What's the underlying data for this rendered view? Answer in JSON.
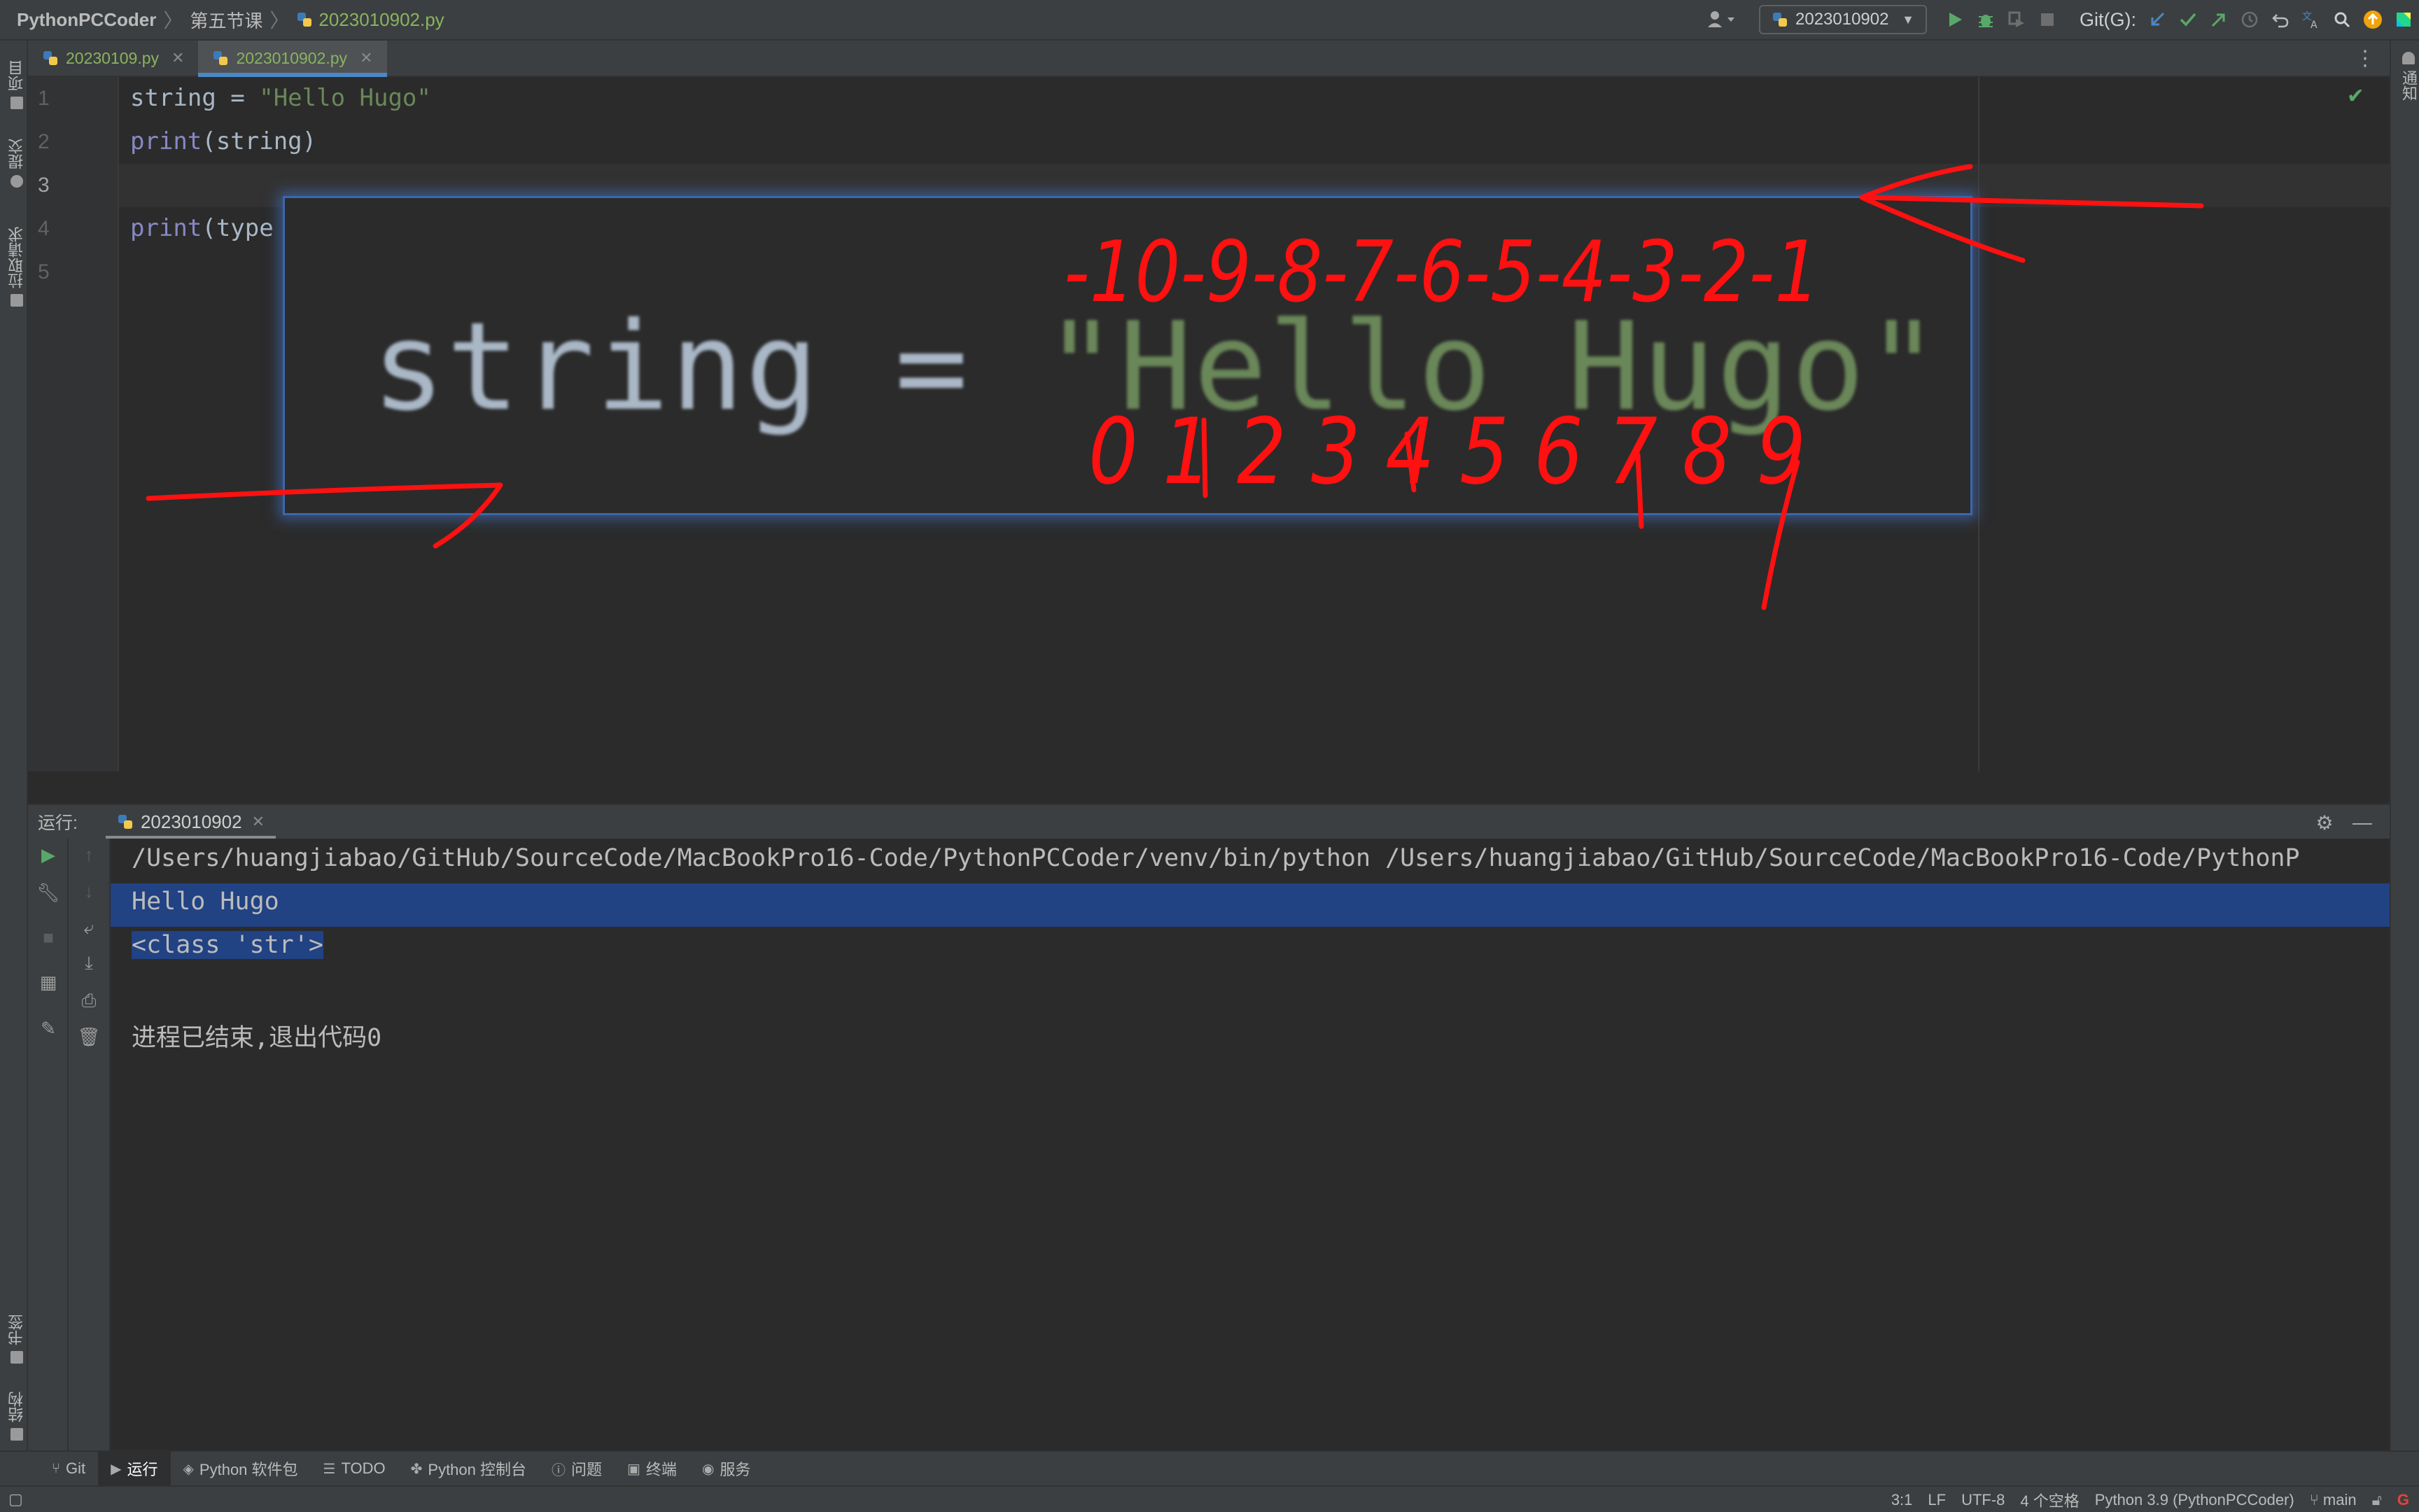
{
  "navbar": {
    "project": "PythonPCCoder",
    "folder": "第五节课",
    "file": "2023010902.py",
    "run_config": "2023010902",
    "git_label": "Git(G):"
  },
  "tabs": [
    {
      "label": "20230109.py",
      "active": false
    },
    {
      "label": "2023010902.py",
      "active": true
    }
  ],
  "left_strip": {
    "project": "项目",
    "commit": "提交",
    "pull_requests": "拉取请求",
    "bookmarks": "书签",
    "structure": "结构"
  },
  "right_strip": {
    "notifications": "通知"
  },
  "editor": {
    "line_numbers": [
      "1",
      "2",
      "3",
      "4",
      "5"
    ],
    "line1": {
      "var": "string = ",
      "str": "\"Hello Hugo\""
    },
    "line2": {
      "fn": "print",
      "rest": "(string)"
    },
    "line4": {
      "fn": "print",
      "rest": "(type"
    },
    "zoom": {
      "var": "string = ",
      "str": "\"Hello Hugo\""
    }
  },
  "annotations": {
    "negative_indices": "-10-9-8-7-6-5-4-3-2-1",
    "positive_indices": "0 1 2 3 4 5 6 7 8 9",
    "color": "#ff1111"
  },
  "run_panel": {
    "label": "运行:",
    "tab": "2023010902",
    "console": [
      "/Users/huangjiabao/GitHub/SourceCode/MacBookPro16-Code/PythonPCCoder/venv/bin/python /Users/huangjiabao/GitHub/SourceCode/MacBookPro16-Code/PythonP",
      "Hello Hugo",
      "<class 'str'>",
      "",
      "进程已结束,退出代码0"
    ]
  },
  "tool_windows": [
    {
      "label": "Git",
      "icon": "git-branch-icon",
      "active": false
    },
    {
      "label": "运行",
      "icon": "play-icon",
      "active": true
    },
    {
      "label": "Python 软件包",
      "icon": "layers-icon",
      "active": false
    },
    {
      "label": "TODO",
      "icon": "list-icon",
      "active": false
    },
    {
      "label": "Python 控制台",
      "icon": "python-icon",
      "active": false
    },
    {
      "label": "问题",
      "icon": "info-icon",
      "active": false
    },
    {
      "label": "终端",
      "icon": "terminal-icon",
      "active": false
    },
    {
      "label": "服务",
      "icon": "service-icon",
      "active": false
    }
  ],
  "status": {
    "position": "3:1",
    "line_sep": "LF",
    "encoding": "UTF-8",
    "indent": "4 个空格",
    "interpreter": "Python 3.9 (PythonPCCoder)",
    "branch": "main"
  },
  "colors": {
    "string": "#6a8759",
    "keyword_builtin": "#8888c6",
    "selection": "#214283",
    "accent": "#4a88c7",
    "success": "#59a869"
  }
}
